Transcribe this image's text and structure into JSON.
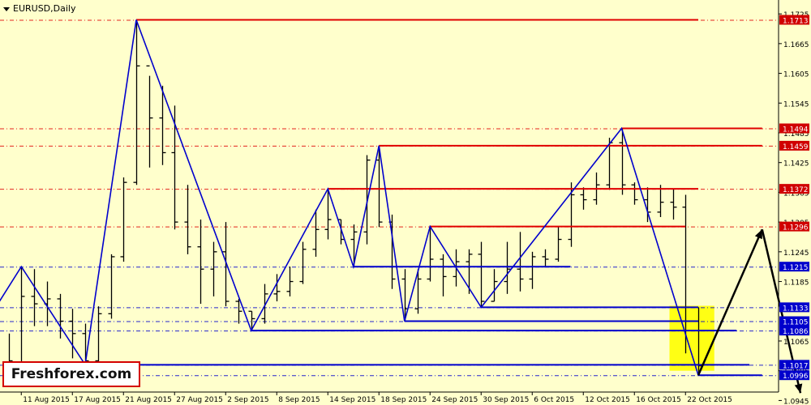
{
  "chart_title": "EURUSD,Daily",
  "logo_text": "Freshforex.com",
  "colors": {
    "background": "#FFFFCC",
    "axis": "#000000",
    "zigzag": "#0000CC",
    "resistance": "#E00000",
    "support": "#0000CC",
    "highlight": "#FFFF00",
    "price_tag_red": "#D00000",
    "price_tag_blue": "#0000CC",
    "forecast": "#000000"
  },
  "chart_data": {
    "type": "ohlc",
    "symbol": "EURUSD",
    "timeframe": "Daily",
    "ylim": [
      1.0962,
      1.1753
    ],
    "y_ticks": [
      "1.1725",
      "1.1665",
      "1.1605",
      "1.1545",
      "1.1485",
      "1.1425",
      "1.1365",
      "1.1305",
      "1.1245",
      "1.1185",
      "1.1065",
      "1.1005",
      "1.0945"
    ],
    "x_labels": [
      {
        "label": "11 Aug 2015",
        "date": "2015-08-11"
      },
      {
        "label": "17 Aug 2015",
        "date": "2015-08-17"
      },
      {
        "label": "21 Aug 2015",
        "date": "2015-08-21"
      },
      {
        "label": "27 Aug 2015",
        "date": "2015-08-27"
      },
      {
        "label": "2 Sep 2015",
        "date": "2015-09-02"
      },
      {
        "label": "8 Sep 2015",
        "date": "2015-09-08"
      },
      {
        "label": "14 Sep 2015",
        "date": "2015-09-14"
      },
      {
        "label": "18 Sep 2015",
        "date": "2015-09-18"
      },
      {
        "label": "24 Sep 2015",
        "date": "2015-09-24"
      },
      {
        "label": "30 Sep 2015",
        "date": "2015-09-30"
      },
      {
        "label": "6 Oct 2015",
        "date": "2015-10-06"
      },
      {
        "label": "12 Oct 2015",
        "date": "2015-10-12"
      },
      {
        "label": "16 Oct 2015",
        "date": "2015-10-16"
      },
      {
        "label": "22 Oct 2015",
        "date": "2015-10-22"
      }
    ],
    "bars": [
      {
        "date": "2015-08-10",
        "o": 1.0995,
        "h": 1.108,
        "l": 1.0985,
        "c": 1.1025
      },
      {
        "date": "2015-08-11",
        "o": 1.1015,
        "h": 1.1215,
        "l": 1.101,
        "c": 1.1155
      },
      {
        "date": "2015-08-12",
        "o": 1.1155,
        "h": 1.121,
        "l": 1.1095,
        "c": 1.114
      },
      {
        "date": "2015-08-13",
        "o": 1.114,
        "h": 1.1185,
        "l": 1.1095,
        "c": 1.115
      },
      {
        "date": "2015-08-14",
        "o": 1.115,
        "h": 1.116,
        "l": 1.107,
        "c": 1.1105
      },
      {
        "date": "2015-08-17",
        "o": 1.1105,
        "h": 1.113,
        "l": 1.103,
        "c": 1.108
      },
      {
        "date": "2015-08-18",
        "o": 1.108,
        "h": 1.11,
        "l": 1.1017,
        "c": 1.1025
      },
      {
        "date": "2015-08-19",
        "o": 1.1025,
        "h": 1.1135,
        "l": 1.102,
        "c": 1.112
      },
      {
        "date": "2015-08-20",
        "o": 1.112,
        "h": 1.124,
        "l": 1.111,
        "c": 1.1235
      },
      {
        "date": "2015-08-21",
        "o": 1.1235,
        "h": 1.1395,
        "l": 1.1225,
        "c": 1.1385
      },
      {
        "date": "2015-08-24",
        "o": 1.1385,
        "h": 1.1713,
        "l": 1.138,
        "c": 1.162
      },
      {
        "date": "2015-08-25",
        "o": 1.162,
        "h": 1.16,
        "l": 1.1415,
        "c": 1.1515
      },
      {
        "date": "2015-08-26",
        "o": 1.1515,
        "h": 1.158,
        "l": 1.142,
        "c": 1.1445
      },
      {
        "date": "2015-08-27",
        "o": 1.1445,
        "h": 1.154,
        "l": 1.129,
        "c": 1.1305
      },
      {
        "date": "2015-08-28",
        "o": 1.1305,
        "h": 1.138,
        "l": 1.124,
        "c": 1.1255
      },
      {
        "date": "2015-08-31",
        "o": 1.1255,
        "h": 1.131,
        "l": 1.114,
        "c": 1.121
      },
      {
        "date": "2015-09-01",
        "o": 1.121,
        "h": 1.1265,
        "l": 1.1155,
        "c": 1.1245
      },
      {
        "date": "2015-09-02",
        "o": 1.1245,
        "h": 1.1305,
        "l": 1.1135,
        "c": 1.1145
      },
      {
        "date": "2015-09-03",
        "o": 1.1145,
        "h": 1.115,
        "l": 1.11,
        "c": 1.1125
      },
      {
        "date": "2015-09-04",
        "o": 1.1125,
        "h": 1.1125,
        "l": 1.1086,
        "c": 1.111
      },
      {
        "date": "2015-09-07",
        "o": 1.111,
        "h": 1.118,
        "l": 1.11,
        "c": 1.116
      },
      {
        "date": "2015-09-08",
        "o": 1.116,
        "h": 1.12,
        "l": 1.1145,
        "c": 1.1165
      },
      {
        "date": "2015-09-09",
        "o": 1.1165,
        "h": 1.1215,
        "l": 1.1155,
        "c": 1.1185
      },
      {
        "date": "2015-09-10",
        "o": 1.1185,
        "h": 1.1265,
        "l": 1.118,
        "c": 1.125
      },
      {
        "date": "2015-09-11",
        "o": 1.125,
        "h": 1.133,
        "l": 1.1235,
        "c": 1.129
      },
      {
        "date": "2015-09-14",
        "o": 1.129,
        "h": 1.1372,
        "l": 1.127,
        "c": 1.131
      },
      {
        "date": "2015-09-15",
        "o": 1.131,
        "h": 1.131,
        "l": 1.126,
        "c": 1.127
      },
      {
        "date": "2015-09-16",
        "o": 1.127,
        "h": 1.13,
        "l": 1.1215,
        "c": 1.1285
      },
      {
        "date": "2015-09-17",
        "o": 1.1285,
        "h": 1.144,
        "l": 1.126,
        "c": 1.143
      },
      {
        "date": "2015-09-18",
        "o": 1.143,
        "h": 1.1459,
        "l": 1.1295,
        "c": 1.1305
      },
      {
        "date": "2015-09-21",
        "o": 1.1305,
        "h": 1.132,
        "l": 1.117,
        "c": 1.119
      },
      {
        "date": "2015-09-22",
        "o": 1.119,
        "h": 1.121,
        "l": 1.1105,
        "c": 1.113
      },
      {
        "date": "2015-09-23",
        "o": 1.113,
        "h": 1.121,
        "l": 1.112,
        "c": 1.119
      },
      {
        "date": "2015-09-24",
        "o": 1.119,
        "h": 1.1295,
        "l": 1.1185,
        "c": 1.123
      },
      {
        "date": "2015-09-25",
        "o": 1.123,
        "h": 1.124,
        "l": 1.1155,
        "c": 1.1195
      },
      {
        "date": "2015-09-28",
        "o": 1.1195,
        "h": 1.125,
        "l": 1.1175,
        "c": 1.1225
      },
      {
        "date": "2015-09-29",
        "o": 1.1225,
        "h": 1.125,
        "l": 1.116,
        "c": 1.124
      },
      {
        "date": "2015-09-30",
        "o": 1.124,
        "h": 1.1265,
        "l": 1.1133,
        "c": 1.1145
      },
      {
        "date": "2015-10-01",
        "o": 1.1145,
        "h": 1.121,
        "l": 1.1145,
        "c": 1.1185
      },
      {
        "date": "2015-10-02",
        "o": 1.1185,
        "h": 1.1265,
        "l": 1.116,
        "c": 1.121
      },
      {
        "date": "2015-10-05",
        "o": 1.121,
        "h": 1.1285,
        "l": 1.1165,
        "c": 1.119
      },
      {
        "date": "2015-10-06",
        "o": 1.119,
        "h": 1.1245,
        "l": 1.117,
        "c": 1.1235
      },
      {
        "date": "2015-10-07",
        "o": 1.1235,
        "h": 1.125,
        "l": 1.1215,
        "c": 1.123
      },
      {
        "date": "2015-10-08",
        "o": 1.123,
        "h": 1.1295,
        "l": 1.1225,
        "c": 1.127
      },
      {
        "date": "2015-10-09",
        "o": 1.127,
        "h": 1.1385,
        "l": 1.1255,
        "c": 1.136
      },
      {
        "date": "2015-10-12",
        "o": 1.136,
        "h": 1.1375,
        "l": 1.133,
        "c": 1.135
      },
      {
        "date": "2015-10-13",
        "o": 1.135,
        "h": 1.1405,
        "l": 1.134,
        "c": 1.138
      },
      {
        "date": "2015-10-14",
        "o": 1.138,
        "h": 1.1475,
        "l": 1.137,
        "c": 1.1465
      },
      {
        "date": "2015-10-15",
        "o": 1.1465,
        "h": 1.1494,
        "l": 1.136,
        "c": 1.138
      },
      {
        "date": "2015-10-16",
        "o": 1.138,
        "h": 1.1385,
        "l": 1.134,
        "c": 1.135
      },
      {
        "date": "2015-10-19",
        "o": 1.135,
        "h": 1.1375,
        "l": 1.1305,
        "c": 1.1325
      },
      {
        "date": "2015-10-20",
        "o": 1.1325,
        "h": 1.138,
        "l": 1.1315,
        "c": 1.1345
      },
      {
        "date": "2015-10-21",
        "o": 1.1345,
        "h": 1.1372,
        "l": 1.131,
        "c": 1.1335
      },
      {
        "date": "2015-10-22",
        "o": 1.1335,
        "h": 1.136,
        "l": 1.104,
        "c": 1.1105
      },
      {
        "date": "2015-10-23",
        "o": 1.1105,
        "h": 1.1133,
        "l": 1.0996,
        "c": 1.1015
      }
    ],
    "zigzag": [
      {
        "date": "2015-08-07",
        "price": 1.1133
      },
      {
        "date": "2015-08-11",
        "price": 1.1215
      },
      {
        "date": "2015-08-18",
        "price": 1.1017
      },
      {
        "date": "2015-08-24",
        "price": 1.1713
      },
      {
        "date": "2015-09-04",
        "price": 1.1086
      },
      {
        "date": "2015-09-14",
        "price": 1.1372
      },
      {
        "date": "2015-09-16",
        "price": 1.1215
      },
      {
        "date": "2015-09-18",
        "price": 1.1459
      },
      {
        "date": "2015-09-22",
        "price": 1.1105
      },
      {
        "date": "2015-09-24",
        "price": 1.1296
      },
      {
        "date": "2015-09-30",
        "price": 1.1133
      },
      {
        "date": "2015-10-15",
        "price": 1.1494
      },
      {
        "date": "2015-10-23",
        "price": 1.0996
      }
    ],
    "levels": [
      {
        "price": 1.1713,
        "label": "1.1713",
        "kind": "resistance",
        "from": "2015-08-24",
        "to": "2015-10-23"
      },
      {
        "price": 1.1494,
        "label": "1.1494",
        "kind": "resistance",
        "from": "2015-10-15",
        "to": "2015-10-29"
      },
      {
        "price": 1.1459,
        "label": "1.1459",
        "kind": "resistance",
        "from": "2015-09-18",
        "to": "2015-10-29"
      },
      {
        "price": 1.1372,
        "label": "1.1372",
        "kind": "resistance",
        "from": "2015-09-14",
        "to": "2015-10-23"
      },
      {
        "price": 1.1296,
        "label": "1.1296",
        "kind": "resistance",
        "from": "2015-09-24",
        "to": "2015-10-22"
      },
      {
        "price": 1.1215,
        "label": "1.1215",
        "kind": "support",
        "from": "2015-09-16",
        "to": "2015-10-09"
      },
      {
        "price": 1.1133,
        "label": "1.1133",
        "kind": "support",
        "from": "2015-09-30",
        "to": "2015-10-23"
      },
      {
        "price": 1.1105,
        "label": "1.1105",
        "kind": "support",
        "from": "2015-09-22",
        "to": "2015-10-23"
      },
      {
        "price": 1.1086,
        "label": "1.1086",
        "kind": "support",
        "from": "2015-09-04",
        "to": "2015-10-26"
      },
      {
        "price": 1.1017,
        "label": "1.1017",
        "kind": "support",
        "from": "2015-08-18",
        "to": "2015-10-27"
      },
      {
        "price": 1.0996,
        "label": "1.0996",
        "kind": "support",
        "from": "2015-10-23",
        "to": "2015-10-29"
      }
    ],
    "dash_levels": [
      1.1713,
      1.1494,
      1.1459,
      1.1372,
      1.1296,
      1.1215,
      1.1133,
      1.1105,
      1.1086,
      1.1017,
      1.0996
    ],
    "highlight_zone": {
      "from": "2015-10-21",
      "to": "2015-10-24",
      "high": 1.1136,
      "low": 1.1005
    },
    "forecast_arrows": [
      {
        "from_date": "2015-10-23",
        "from_price": 1.0996,
        "to_date": "2015-10-28",
        "to_price": 1.129
      },
      {
        "from_date": "2015-10-28",
        "from_price": 1.129,
        "to_date": "2015-11-02",
        "to_price": 1.096
      }
    ]
  }
}
